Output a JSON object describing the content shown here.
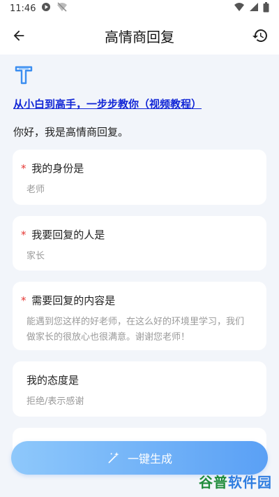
{
  "status_bar": {
    "time": "11:46"
  },
  "app_bar": {
    "title": "高情商回复"
  },
  "tutorial_link": "从小白到高手，一步步教你（视频教程）",
  "greeting": "你好，我是高情商回复。",
  "fields": [
    {
      "label": "我的身份是",
      "value": "老师"
    },
    {
      "label": "我要回复的人是",
      "value": "家长"
    },
    {
      "label": "需要回复的内容是",
      "value": "能遇到您这样的好老师，在这么好的环境里学习，我们做家长的很放心也很满意。谢谢您老师！"
    },
    {
      "label": "我的态度是",
      "value": "拒绝/表示感谢"
    }
  ],
  "generate_button": {
    "label": "一键生成"
  },
  "watermark": {
    "part1": "谷普",
    "part2": "软件园"
  },
  "colors": {
    "accent": "#5aa0f5",
    "link": "#1227d6",
    "required": "#e53935"
  }
}
